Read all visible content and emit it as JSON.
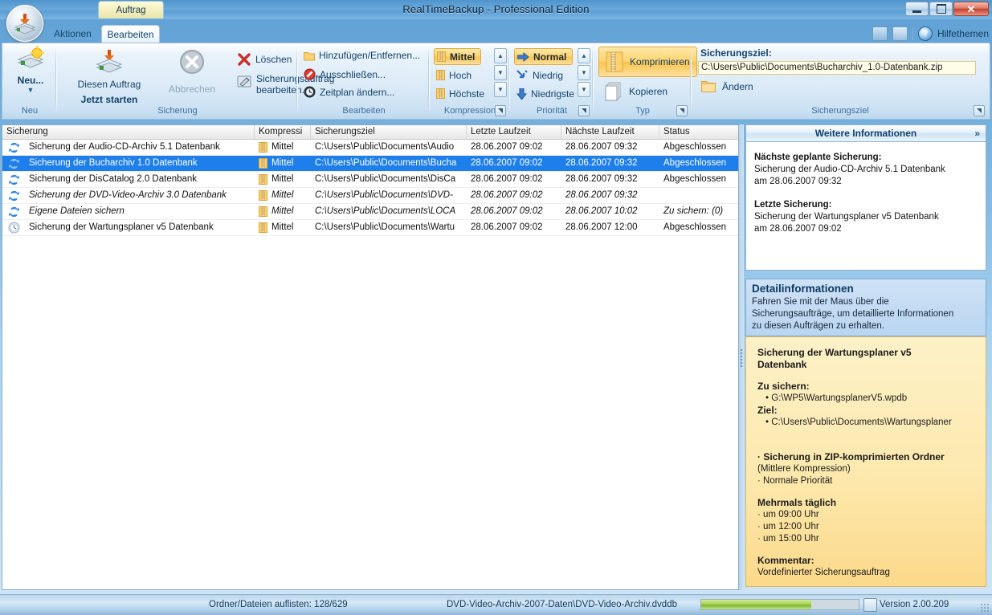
{
  "window": {
    "title": "RealTimeBackup  - Professional Edition",
    "minimize_label": "Minimieren",
    "maximize_label": "Maximieren",
    "close_label": "Schließen"
  },
  "contextual_tab": {
    "label": "Auftrag"
  },
  "tabs": [
    {
      "label": "Aktionen",
      "active": false
    },
    {
      "label": "Bearbeiten",
      "active": true
    }
  ],
  "help": {
    "label": "Hilfethemen"
  },
  "ribbon": {
    "groups": [
      {
        "label": "Neu"
      },
      {
        "label": "Sicherung"
      },
      {
        "label": "Bearbeiten"
      },
      {
        "label": "Kompression"
      },
      {
        "label": "Priorität"
      },
      {
        "label": "Typ"
      },
      {
        "label": "Sicherungsziel"
      }
    ],
    "new_button": {
      "label": "Neu...",
      "caret": "▼"
    },
    "sicherung": {
      "start_line1": "Diesen Auftrag",
      "start_line2": "Jetzt starten",
      "cancel": "Abbrechen",
      "delete": "Löschen",
      "edit_line1": "Sicherungsauftrag",
      "edit_line2": "bearbeiten..."
    },
    "bearbeiten": {
      "add_remove": "Hinzufügen/Entfernen...",
      "exclude": "Ausschließen...",
      "schedule": "Zeitplan ändern..."
    },
    "kompression": {
      "options": [
        "Mittel",
        "Hoch",
        "Höchste"
      ],
      "selected": "Mittel"
    },
    "prioritaet": {
      "options": [
        "Normal",
        "Niedrig",
        "Niedrigste"
      ],
      "selected": "Normal"
    },
    "typ": {
      "options": [
        "Komprimieren",
        "Kopieren"
      ],
      "selected": "Komprimieren"
    },
    "sicherungsziel": {
      "title": "Sicherungsziel:",
      "path": "C:\\Users\\Public\\Documents\\Bucharchiv_1.0-Datenbank.zip",
      "change": "Ändern"
    }
  },
  "table": {
    "columns": [
      "Sicherung",
      "Kompressi",
      "Sicherungsziel",
      "Letzte Laufzeit",
      "Nächste Laufzeit",
      "Status"
    ],
    "rows": [
      {
        "icon": "sync-icon",
        "name": "Sicherung der Audio-CD-Archiv 5.1 Datenbank",
        "compression": "Mittel",
        "target": "C:\\Users\\Public\\Documents\\Audio",
        "last_run": "28.06.2007 09:02",
        "next_run": "28.06.2007 09:32",
        "status": "Abgeschlossen",
        "selected": false,
        "italic": false
      },
      {
        "icon": "sync-icon",
        "name": "Sicherung der Bucharchiv 1.0 Datenbank",
        "compression": "Mittel",
        "target": "C:\\Users\\Public\\Documents\\Bucha",
        "last_run": "28.06.2007 09:02",
        "next_run": "28.06.2007 09:32",
        "status": "Abgeschlossen",
        "selected": true,
        "italic": false
      },
      {
        "icon": "sync-icon",
        "name": "Sicherung der DisCatalog 2.0 Datenbank",
        "compression": "Mittel",
        "target": "C:\\Users\\Public\\Documents\\DisCa",
        "last_run": "28.06.2007 09:02",
        "next_run": "28.06.2007 09:32",
        "status": "Abgeschlossen",
        "selected": false,
        "italic": false
      },
      {
        "icon": "sync-icon",
        "name": "Sicherung der DVD-Video-Archiv 3.0 Datenbank",
        "compression": "Mittel",
        "target": "C:\\Users\\Public\\Documents\\DVD-",
        "last_run": "28.06.2007 09:02",
        "next_run": "28.06.2007 09:32",
        "status": "",
        "selected": false,
        "italic": true
      },
      {
        "icon": "sync-icon",
        "name": "Eigene Dateien sichern",
        "compression": "Mittel",
        "target": "C:\\Users\\Public\\Documents\\LOCA",
        "last_run": "28.06.2007 09:02",
        "next_run": "28.06.2007 10:02",
        "status": "Zu sichern: (0)",
        "selected": false,
        "italic": true
      },
      {
        "icon": "clock-icon",
        "name": "Sicherung der Wartungsplaner v5 Datenbank",
        "compression": "Mittel",
        "target": "C:\\Users\\Public\\Documents\\Wartu",
        "last_run": "28.06.2007 09:02",
        "next_run": "28.06.2007 12:00",
        "status": "Abgeschlossen",
        "selected": false,
        "italic": false
      }
    ]
  },
  "right_panel": {
    "header": "Weitere Informationen",
    "expand_glyph": "»",
    "next_backup_title": "Nächste geplante Sicherung:",
    "next_backup_line1": "Sicherung der Audio-CD-Archiv 5.1 Datenbank",
    "next_backup_line2": "am 28.06.2007 09:32",
    "last_backup_title": "Letzte Sicherung:",
    "last_backup_line1": "Sicherung der Wartungsplaner v5 Datenbank",
    "last_backup_line2": "am 28.06.2007 09:02",
    "detail_header": "Detailinformationen",
    "detail_hint_l1": "Fahren Sie mit der Maus über die",
    "detail_hint_l2": "Sicherungsaufträge, um detaillierte Informationen",
    "detail_hint_l3": "zu diesen Aufträgen zu erhalten.",
    "detail": {
      "title_l1": "Sicherung der Wartungsplaner v5",
      "title_l2": "Datenbank",
      "source_label": "Zu sichern:",
      "source_value": "• G:\\WP5\\WartungsplanerV5.wpdb",
      "target_label": "Ziel:",
      "target_value": "• C:\\Users\\Public\\Documents\\Wartungsplaner",
      "type_line": "· Sicherung in ZIP-komprimierten Ordner",
      "type_sub": "(Mittlere Kompression)",
      "priority_line": "· Normale Priorität",
      "schedule_title": "Mehrmals täglich",
      "schedule_items": [
        "· um 09:00 Uhr",
        "· um 12:00 Uhr",
        "· um 15:00 Uhr"
      ],
      "comment_label": "Kommentar:",
      "comment_value": "Vordefinierter Sicherungsauftrag"
    }
  },
  "statusbar": {
    "task": "Ordner/Dateien auflisten: 128/629",
    "file": "DVD-Video-Archiv-2007-Daten\\DVD-Video-Archiv.dvddb",
    "progress_percent": 70,
    "version": "Version 2.00.209"
  },
  "colors": {
    "selection_blue": "#1f7fea",
    "accent_gold": "#ffc34c",
    "panel_yellow": "#fde9ae",
    "title_blue": "#4f94cd"
  }
}
